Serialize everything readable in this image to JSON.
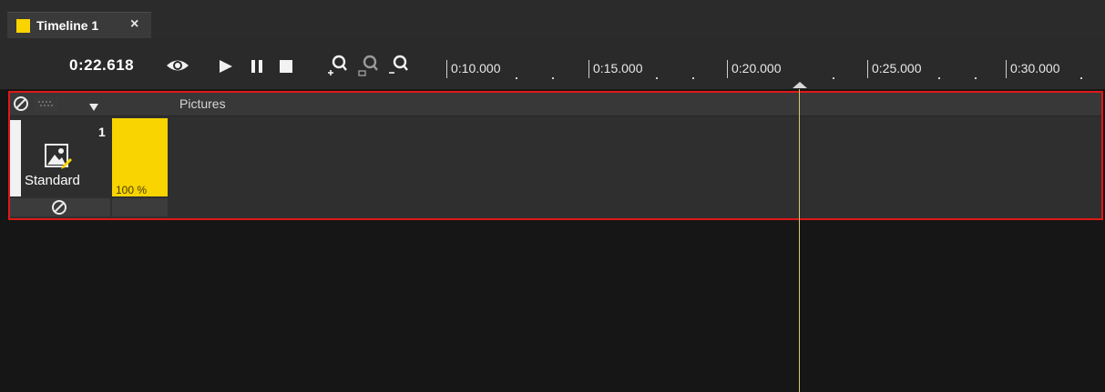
{
  "tab": {
    "label": "Timeline 1",
    "close_glyph": "×",
    "swatch_color": "#f9d400",
    "swatch_icon": "yellow-square-icon"
  },
  "toolbar": {
    "time": "0:22.618",
    "icons": [
      "eye-icon",
      "play-icon",
      "pause-icon",
      "stop-icon",
      "zoom-in-icon",
      "zoom-fit-icon",
      "zoom-out-icon"
    ]
  },
  "ruler": {
    "labels": [
      "0:10.000",
      "0:15.000",
      "0:20.000",
      "0:25.000",
      "0:30.000"
    ]
  },
  "panel": {
    "header_label": "Pictures",
    "header_icons": [
      "disable-icon",
      "dots-grid-icon",
      "dropdown-arrow-icon"
    ],
    "layer": {
      "number": "1",
      "name": "Standard",
      "icon": "picture-layer-icon",
      "footer_icon": "disable-icon"
    },
    "cue": {
      "percent": "100 %",
      "color": "#f9d400"
    }
  },
  "colors": {
    "highlight_border": "#e01818",
    "playhead": "#d8c870",
    "accent": "#f9d400"
  }
}
